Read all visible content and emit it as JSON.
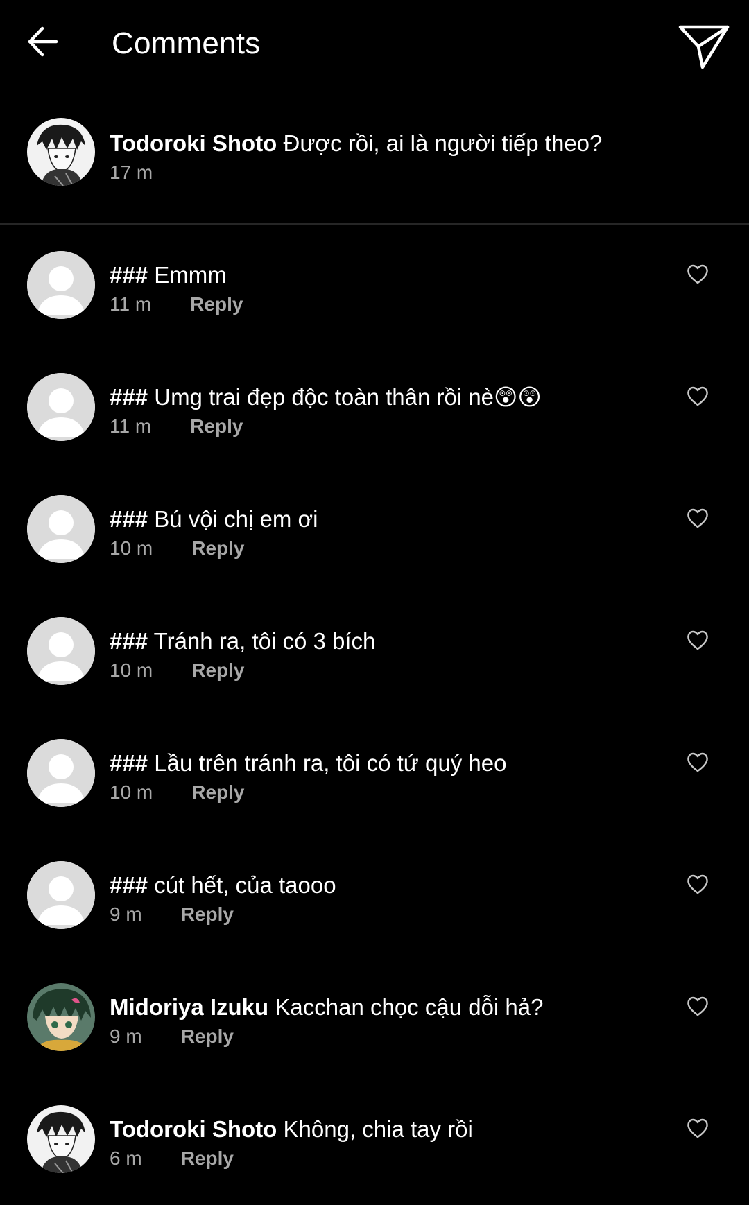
{
  "header": {
    "title": "Comments",
    "back_icon": "arrow-left-icon",
    "send_icon": "paper-plane-icon"
  },
  "caption": {
    "username": "Todoroki Shoto",
    "text": "Được rồi, ai là người tiếp theo?",
    "time": "17 m"
  },
  "reply_label": "Reply",
  "comments": [
    {
      "username": "###",
      "text": "Emmm",
      "time": "11 m",
      "avatar": "default"
    },
    {
      "username": "###",
      "text": "Umg trai đẹp độc toàn thân rồi nè😲😲",
      "time": "11 m",
      "avatar": "default"
    },
    {
      "username": "###",
      "text": "Bú vội chị em ơi",
      "time": "10 m",
      "avatar": "default"
    },
    {
      "username": "###",
      "text": "Tránh ra, tôi có 3 bích",
      "time": "10 m",
      "avatar": "default"
    },
    {
      "username": "###",
      "text": "Lầu trên tránh ra, tôi có tứ quý heo",
      "time": "10 m",
      "avatar": "default"
    },
    {
      "username": "###",
      "text": "cút hết, của taooo",
      "time": "9 m",
      "avatar": "default"
    },
    {
      "username": "Midoriya Izuku",
      "text": "Kacchan chọc cậu dỗi hả?",
      "time": "9 m",
      "avatar": "midoriya"
    },
    {
      "username": "Todoroki Shoto",
      "text": "Không, chia tay rồi",
      "time": "6 m",
      "avatar": "todoroki"
    }
  ],
  "colors": {
    "background": "#000000",
    "text": "#ffffff",
    "secondary": "#a8a8a8",
    "divider": "#262626",
    "default_avatar": "#dbdbdb"
  }
}
